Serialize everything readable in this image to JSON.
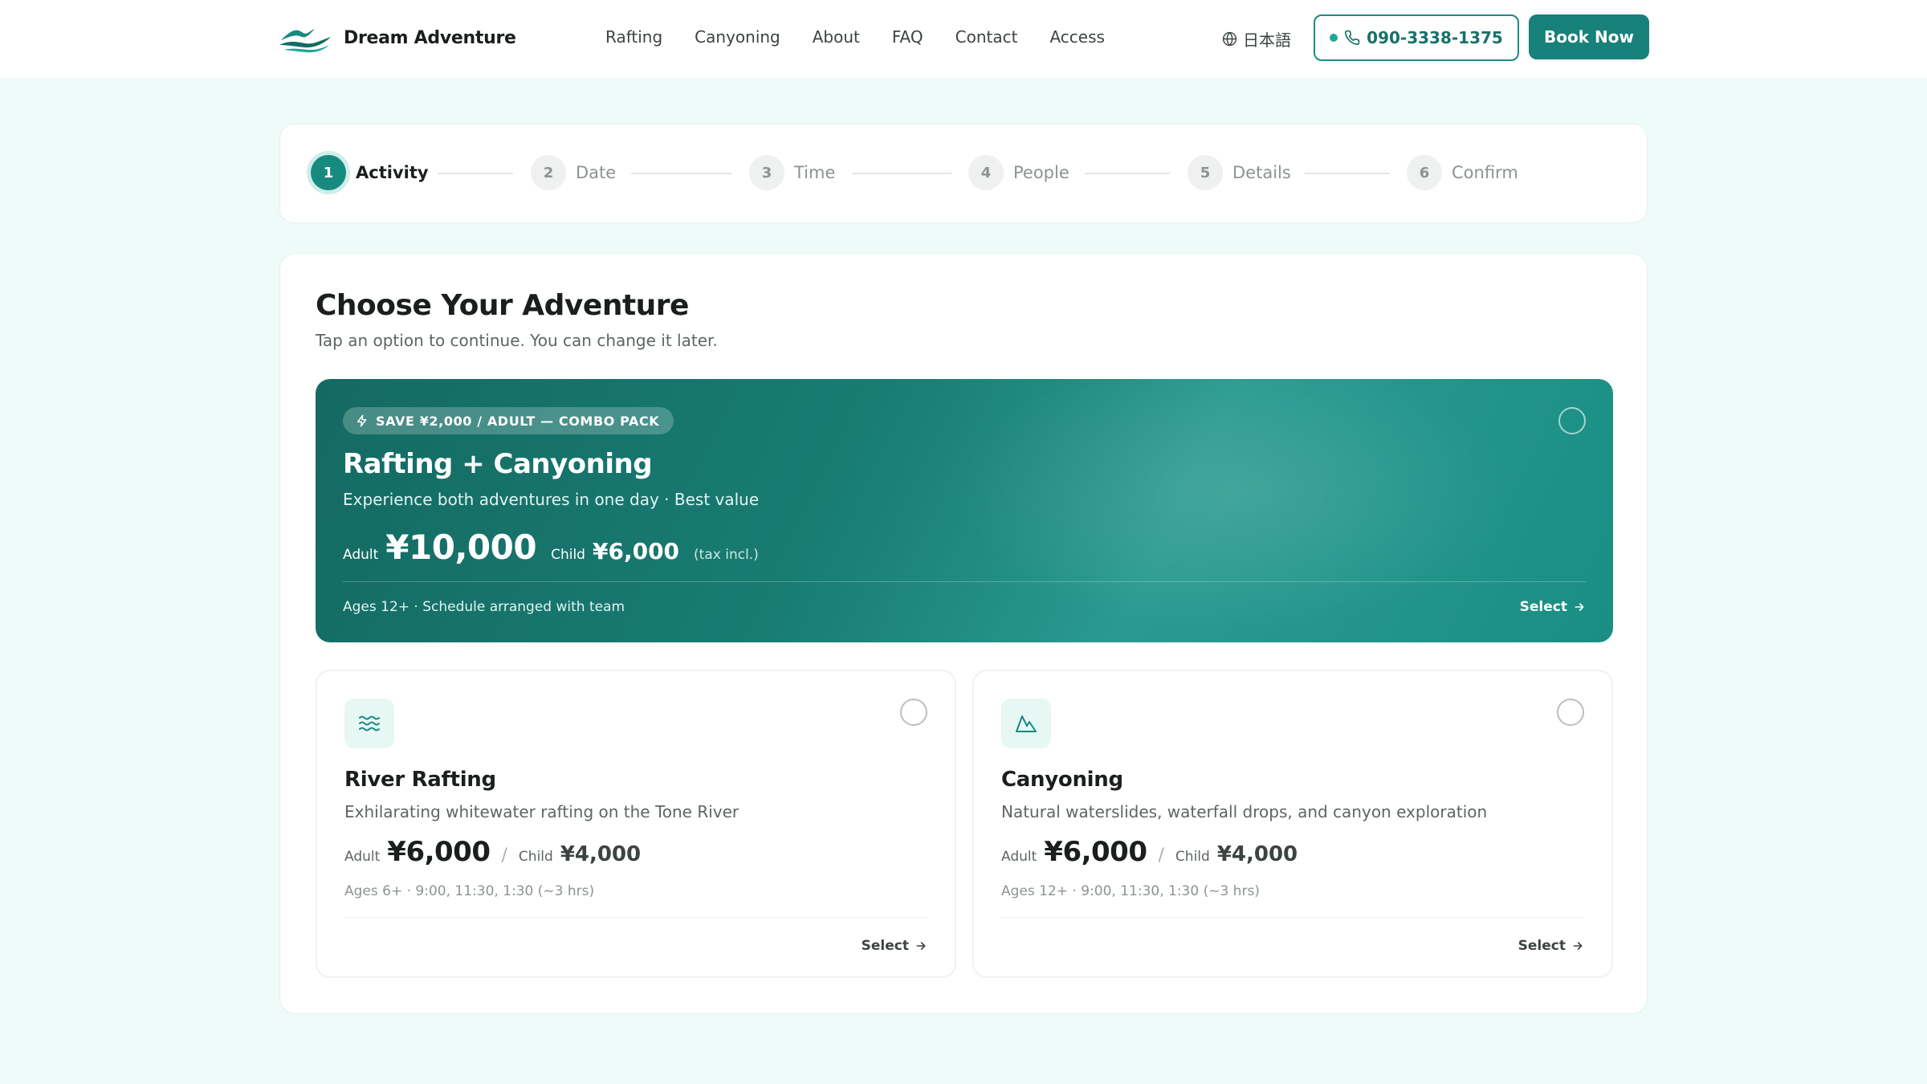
{
  "header": {
    "brand": "Dream Adventure",
    "nav": [
      "Rafting",
      "Canyoning",
      "About",
      "FAQ",
      "Contact",
      "Access"
    ],
    "language": "日本語",
    "phone": "090-3338-1375",
    "book_now": "Book Now"
  },
  "steps": [
    {
      "num": "1",
      "label": "Activity",
      "active": true
    },
    {
      "num": "2",
      "label": "Date"
    },
    {
      "num": "3",
      "label": "Time"
    },
    {
      "num": "4",
      "label": "People"
    },
    {
      "num": "5",
      "label": "Details"
    },
    {
      "num": "6",
      "label": "Confirm"
    }
  ],
  "main": {
    "title": "Choose Your Adventure",
    "subtitle": "Tap an option to continue. You can change it later."
  },
  "combo": {
    "badge": "SAVE ¥2,000 / ADULT — COMBO PACK",
    "title": "Rafting + Canyoning",
    "description": "Experience both adventures in one day · Best value",
    "adult_label": "Adult",
    "adult_price": "¥10,000",
    "child_label": "Child",
    "child_price": "¥6,000",
    "tax_note": "(tax incl.)",
    "meta": "Ages 12+ · Schedule arranged with team",
    "select": "Select"
  },
  "cards": [
    {
      "icon": "waves-icon",
      "title": "River Rafting",
      "description": "Exhilarating whitewater rafting on the Tone River",
      "adult_label": "Adult",
      "adult_price": "¥6,000",
      "separator": "/",
      "child_label": "Child",
      "child_price": "¥4,000",
      "meta": "Ages 6+ · 9:00, 11:30, 1:30 (~3 hrs)",
      "select": "Select"
    },
    {
      "icon": "mountain-icon",
      "title": "Canyoning",
      "description": "Natural waterslides, waterfall drops, and canyon exploration",
      "adult_label": "Adult",
      "adult_price": "¥6,000",
      "separator": "/",
      "child_label": "Child",
      "child_price": "¥4,000",
      "meta": "Ages 12+ · 9:00, 11:30, 1:30 (~3 hrs)",
      "select": "Select"
    }
  ],
  "colors": {
    "accent": "#17817a",
    "background": "#effbf8"
  }
}
